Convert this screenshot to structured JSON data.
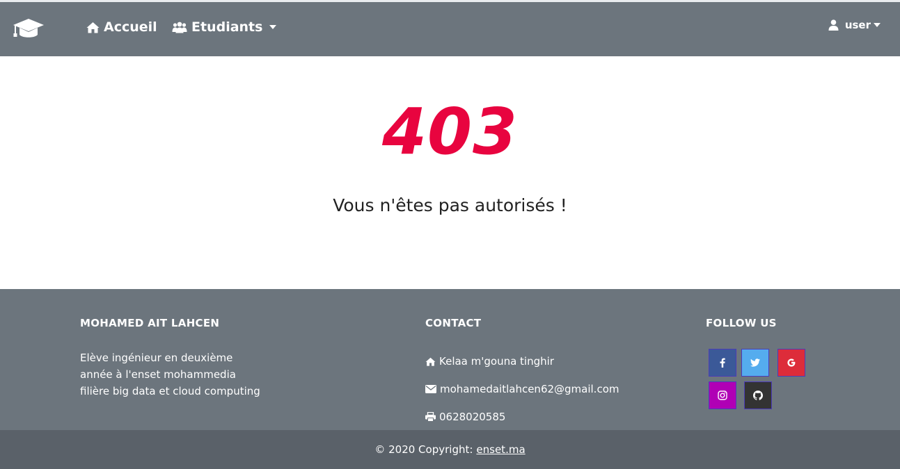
{
  "navbar": {
    "brand_icon": "graduation-cap-icon",
    "home_label": "Accueil",
    "home_icon": "home-icon",
    "students_label": "Etudiants",
    "students_icon": "users-icon",
    "user_label": "user",
    "user_icon": "user-icon",
    "bg_color": "#6c757d"
  },
  "error": {
    "code": "403",
    "message": "Vous n'êtes pas autorisés !",
    "code_color": "#e8043f"
  },
  "footer": {
    "about": {
      "title": "MOHAMED AIT LAHCEN",
      "lines": [
        "Elève ingénieur en deuxième",
        "année à l'enset mohammedia",
        "filière big data et cloud computing"
      ]
    },
    "contact": {
      "title": "CONTACT",
      "address": "Kelaa m'gouna tinghir",
      "email": "mohamedaitlahcen62@gmail.com",
      "phone": "0628020585"
    },
    "follow": {
      "title": "FOLLOW US",
      "networks": [
        "facebook-icon",
        "twitter-icon",
        "google-icon",
        "instagram-icon",
        "github-icon"
      ]
    }
  },
  "copyright": {
    "text": "© 2020 Copyright:",
    "link_label": "enset.ma"
  }
}
